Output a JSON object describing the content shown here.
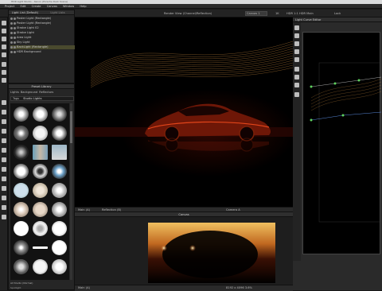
{
  "window": {
    "title": "HDR Light Studio - Xenon (Porsche Dark Scene)"
  },
  "menu": [
    "Project",
    "Edit",
    "Create",
    "Canvas",
    "Window",
    "Help"
  ],
  "toolbar": {
    "render_label": "Render View (Channel/Reflection)",
    "canvas_select": "Canvas 1",
    "res": "1K",
    "hdr_info": "HDR 1:1 HDR Main",
    "lock": "Lock"
  },
  "light_list": {
    "tabs": [
      "Light List (Default)",
      "Light Lists"
    ],
    "items": [
      "Poster Light (Rectangle)",
      "Poster Light (Rectangle)",
      "Strobe Light 02",
      "Strobe Light",
      "Area Light",
      "Sky Light",
      "BackLight (Rectangle)",
      "HDR Background"
    ],
    "selected": 6
  },
  "presets": {
    "title": "Preset Library",
    "tabs": [
      "Lights",
      "Background",
      "Reflectors",
      "Portrait",
      "Misc"
    ],
    "filter_label": "Tags",
    "search": "Studio Lights",
    "footer": "All Studio (Normal)",
    "bottom_label": "Spotlight"
  },
  "viewport": {
    "status_left": "Main (A)",
    "status_mid": "Reflection (B)",
    "status_right": "Camera A"
  },
  "canvas": {
    "title": "Canvas",
    "status_left": "Main (A)",
    "status_right": "8192 x 4096 3.6%"
  },
  "right_panel": {
    "title": "Light Curve Editor"
  },
  "colors": {
    "accent": "#e3b14f",
    "car": "#c1300f",
    "bg": "#000000"
  }
}
